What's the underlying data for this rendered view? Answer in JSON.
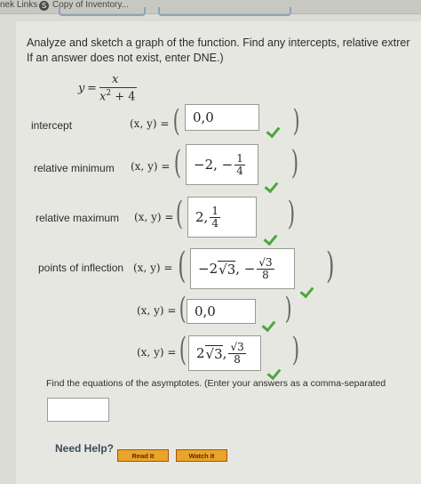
{
  "topbar": {
    "link1": "nek Links",
    "globe": "S",
    "link2": "Copy of Inventory..."
  },
  "instructions": {
    "line1": "Analyze and sketch a graph of the function. Find any intercepts, relative extrer",
    "line2": "If an answer does not exist, enter DNE.)"
  },
  "function": {
    "lhs": "y",
    "eq": "=",
    "numerator": "x",
    "denominator_base": "x",
    "denominator_exp": "2",
    "denominator_rest": " + 4"
  },
  "xy_label": "(x, y) =",
  "rows": [
    {
      "label": "intercept",
      "answer": "0,0"
    },
    {
      "label": "relative minimum",
      "answer_prefix": "−2, −",
      "frac_num": "1",
      "frac_den": "4"
    },
    {
      "label": "relative maximum",
      "answer_prefix": "2,",
      "frac_num": "1",
      "frac_den": "4"
    },
    {
      "label": "points of inflection",
      "answer_a": "−2",
      "sqrt_a": "3",
      "sep": ", −",
      "frac_num_sqrt": "3",
      "frac_den": "8"
    },
    {
      "label": "",
      "answer": "0,0"
    },
    {
      "label": "",
      "answer_a": "2",
      "sqrt_a": "3",
      "sep": ",",
      "frac_num_sqrt": "3",
      "frac_den": "8"
    }
  ],
  "asymptotes": {
    "text": "Find the equations of the asymptotes. (Enter your answers as a comma-separated"
  },
  "help": {
    "label": "Need Help?",
    "read_it": "Read It",
    "watch_it": "Watch It"
  },
  "colors": {
    "check": "#4aa83c",
    "button": "#e8a52a",
    "button_border": "#b24a12"
  }
}
